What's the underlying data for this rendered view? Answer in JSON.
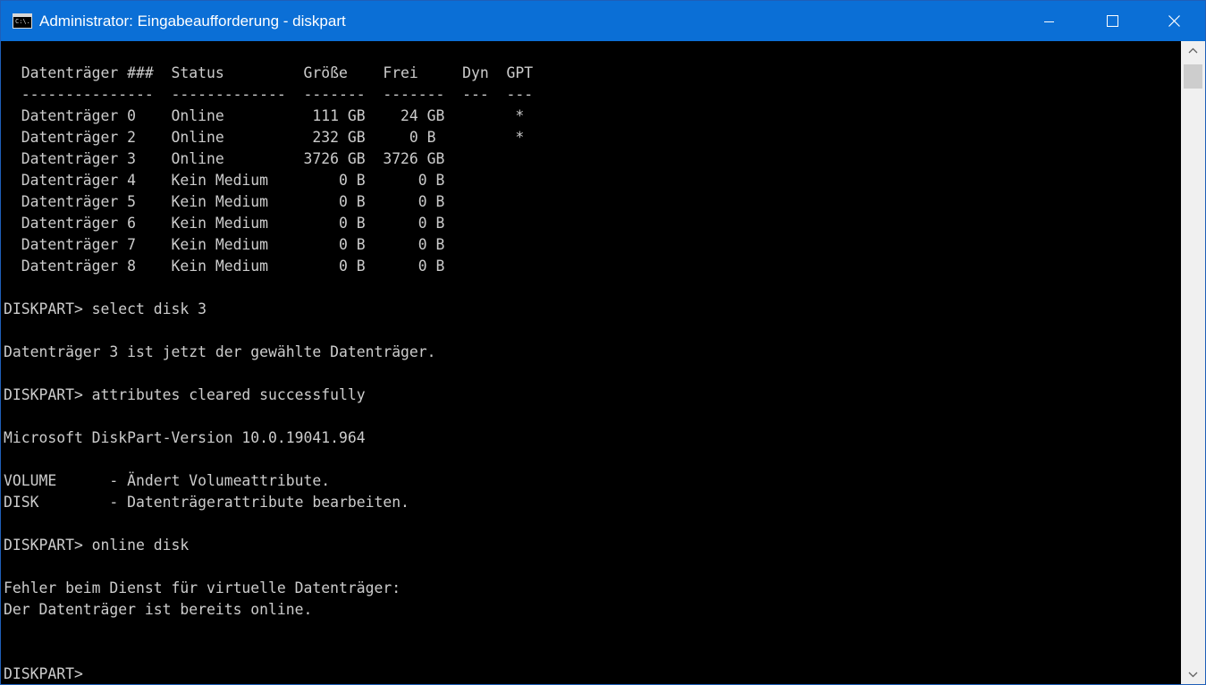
{
  "window": {
    "title": "Administrator: Eingabeaufforderung - diskpart",
    "icon_name": "command-prompt-icon",
    "icon_text": "C:\\."
  },
  "colors": {
    "titlebar": "#0b6fd6",
    "console_background": "#000000",
    "console_text": "#cccccc",
    "scrollbar_track": "#f0f0f0",
    "scrollbar_thumb": "#cdcdcd"
  },
  "console": {
    "lines": [
      "",
      "  Datenträger ###  Status         Größe    Frei     Dyn  GPT",
      "  ---------------  -------------  -------  -------  ---  ---",
      "  Datenträger 0    Online          111 GB    24 GB        *",
      "  Datenträger 2    Online          232 GB     0 B         *",
      "  Datenträger 3    Online         3726 GB  3726 GB",
      "  Datenträger 4    Kein Medium        0 B      0 B",
      "  Datenträger 5    Kein Medium        0 B      0 B",
      "  Datenträger 6    Kein Medium        0 B      0 B",
      "  Datenträger 7    Kein Medium        0 B      0 B",
      "  Datenträger 8    Kein Medium        0 B      0 B",
      "",
      "DISKPART> select disk 3",
      "",
      "Datenträger 3 ist jetzt der gewählte Datenträger.",
      "",
      "DISKPART> attributes cleared successfully",
      "",
      "Microsoft DiskPart-Version 10.0.19041.964",
      "",
      "VOLUME      - Ändert Volumeattribute.",
      "DISK        - Datenträgerattribute bearbeiten.",
      "",
      "DISKPART> online disk",
      "",
      "Fehler beim Dienst für virtuelle Datenträger:",
      "Der Datenträger ist bereits online.",
      "",
      "",
      "DISKPART> "
    ]
  }
}
